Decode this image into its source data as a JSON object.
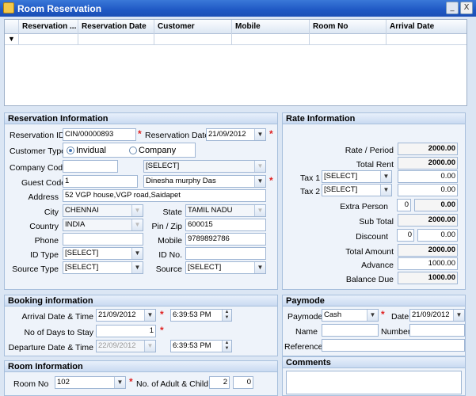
{
  "window": {
    "title": "Room Reservation",
    "minimize": "_",
    "close": "X"
  },
  "grid": {
    "columns": [
      "Reservation ...",
      "Reservation Date",
      "Customer",
      "Mobile",
      "Room No",
      "Arrival Date"
    ],
    "filter_icon": "filter-icon"
  },
  "reservation": {
    "header": "Reservation Information",
    "reservation_id_label": "Reservation ID",
    "reservation_id": "CIN/00000893",
    "reservation_date_label": "Reservation Date",
    "reservation_date": "21/09/2012",
    "customer_type_label": "Customer Type",
    "customer_type_options": [
      "Invidual",
      "Company"
    ],
    "company_code_label": "Company Code",
    "company_code": "",
    "company_select": "[SELECT]",
    "guest_code_label": "Guest Code",
    "guest_code": "1",
    "guest_name": "Dinesha murphy Das",
    "address_label": "Address",
    "address": "52 VGP house,VGP road,Saidapet",
    "city_label": "City",
    "city": "CHENNAI",
    "state_label": "State",
    "state": "TAMIL NADU",
    "country_label": "Country",
    "country": "INDIA",
    "pin_label": "Pin / Zip",
    "pin": "600015",
    "phone_label": "Phone",
    "phone": "",
    "mobile_label": "Mobile",
    "mobile": "9789892786",
    "id_type_label": "ID Type",
    "id_type": "[SELECT]",
    "id_no_label": "ID No.",
    "id_no": "",
    "source_type_label": "Source Type",
    "source_type": "[SELECT]",
    "source_label": "Source",
    "source": "[SELECT]"
  },
  "rate": {
    "header": "Rate Information",
    "rate_period_label": "Rate / Period",
    "rate_period": "2000.00",
    "total_rent_label": "Total Rent",
    "total_rent": "2000.00",
    "tax1_label": "Tax 1",
    "tax1_select": "[SELECT]",
    "tax1_value": "0.00",
    "tax2_label": "Tax 2",
    "tax2_select": "[SELECT]",
    "tax2_value": "0.00",
    "extra_person_label": "Extra Person",
    "extra_person_count": "0",
    "extra_person_value": "0.00",
    "sub_total_label": "Sub Total",
    "sub_total": "2000.00",
    "discount_label": "Discount",
    "discount_pct": "0",
    "discount_value": "0.00",
    "total_amount_label": "Total Amount",
    "total_amount": "2000.00",
    "advance_label": "Advance",
    "advance": "1000.00",
    "balance_due_label": "Balance Due",
    "balance_due": "1000.00"
  },
  "booking": {
    "header": "Booking information",
    "arrival_label": "Arrival Date & Time",
    "arrival_date": "21/09/2012",
    "arrival_time": "6:39:53 PM",
    "days_label": "No of Days to Stay",
    "days": "1",
    "departure_label": "Departure Date & Time",
    "departure_date": "22/09/2012",
    "departure_time": "6:39:53 PM"
  },
  "paymode": {
    "header": "Paymode",
    "paymode_label": "Paymode",
    "paymode": "Cash",
    "date_label": "Date",
    "date": "21/09/2012",
    "name_label": "Name",
    "name": "",
    "number_label": "Number",
    "number": "",
    "reference_label": "Reference",
    "reference": ""
  },
  "room": {
    "header": "Room Information",
    "room_no_label": "Room No",
    "room_no": "102",
    "adult_child_label": "No. of Adult & Child",
    "adults": "2",
    "children": "0"
  },
  "comments": {
    "header": "Comments",
    "text": ""
  },
  "icons": {
    "dropdown": "▼",
    "spin_up": "▲",
    "spin_down": "▼"
  },
  "colors": {
    "title_bar": "#1f58c4",
    "panel_bg": "#eef3fa",
    "required": "#e02020"
  }
}
